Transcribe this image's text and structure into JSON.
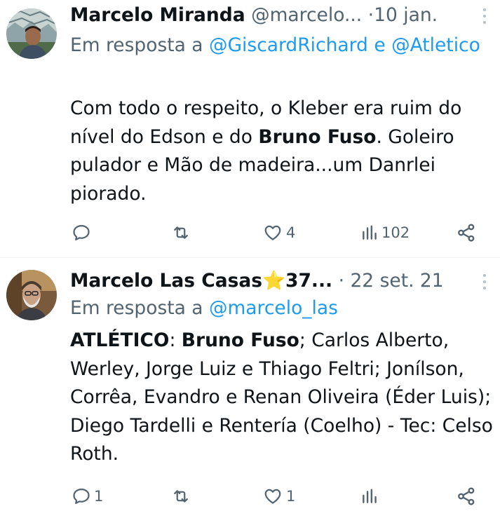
{
  "tweets": [
    {
      "name": "Marcelo Miranda",
      "name_emoji": "",
      "handle": "@marcelo...",
      "separator": "·",
      "time": "10 jan.",
      "reply_prefix": "Em resposta a",
      "mention1": "@GiscardRichard",
      "mention_joiner": "e",
      "mention2": "@Atletico",
      "text_part1": "Com todo o respeito,  o Kleber era ruim do nível do Edson e do ",
      "text_bold": "Bruno Fuso",
      "text_part2": ". Goleiro pulador e Mão de madeira...um Danrlei piorado.",
      "replies": "",
      "retweets": "",
      "likes": "4",
      "views": "102"
    },
    {
      "name": "Marcelo Las Casas",
      "name_emoji": "⭐",
      "name_suffix": "37...",
      "handle": "",
      "separator": "·",
      "time": "22 set. 21",
      "reply_prefix": "Em resposta a",
      "mention1": "@marcelo_las",
      "text_bold1": "ATLÉTICO",
      "text_part1": ": ",
      "text_bold2": "Bruno Fuso",
      "text_part2": "; Carlos Alberto, Werley, Jorge Luiz e Thiago Feltri; Jonílson, Corrêa, Evandro e Renan Oliveira (Éder Luis); Diego Tardelli e Rentería (Coelho) - Tec: Celso Roth.",
      "replies": "1",
      "retweets": "",
      "likes": "1",
      "views": ""
    }
  ],
  "colors": {
    "text": "#0f1419",
    "secondary": "#536471",
    "link": "#1d9bf0",
    "divider": "#eff3f4"
  },
  "icons": [
    "reply-icon",
    "retweet-icon",
    "like-icon",
    "views-icon",
    "share-icon",
    "more-icon"
  ]
}
